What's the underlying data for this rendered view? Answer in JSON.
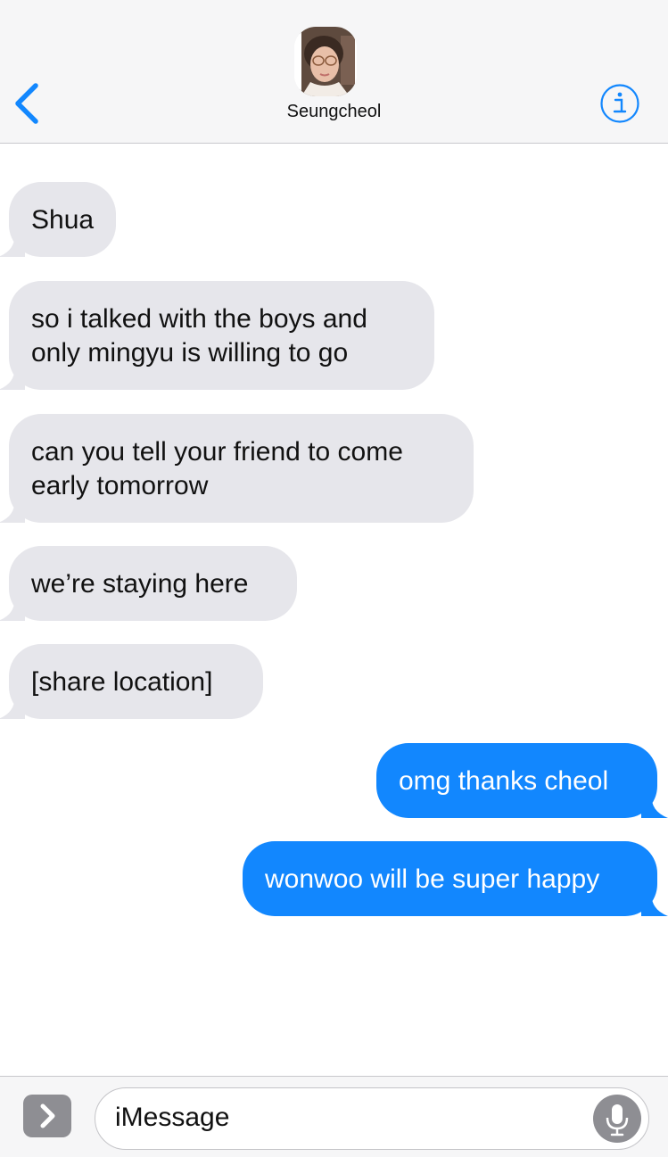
{
  "header": {
    "contact_name": "Seungcheol",
    "back_icon": "chevron-left-icon",
    "info_icon": "info-icon",
    "accent_color": "#1287fe"
  },
  "messages": [
    {
      "direction": "incoming",
      "text_lines": [
        "Shua"
      ]
    },
    {
      "direction": "incoming",
      "text_lines": [
        "so i talked with the boys and",
        "only mingyu is willing to go"
      ]
    },
    {
      "direction": "incoming",
      "text_lines": [
        "can you tell your friend to come",
        "early tomorrow"
      ]
    },
    {
      "direction": "incoming",
      "text_lines": [
        "we’re staying here"
      ]
    },
    {
      "direction": "incoming",
      "text_lines": [
        "[share location]"
      ]
    },
    {
      "direction": "outgoing",
      "text_lines": [
        "omg thanks cheol"
      ]
    },
    {
      "direction": "outgoing",
      "text_lines": [
        "wonwoo will be super happy"
      ]
    }
  ],
  "colors": {
    "incoming_bubble": "#e6e6eb",
    "outgoing_bubble": "#1287fe"
  },
  "composer": {
    "placeholder": "iMessage",
    "apps_icon": "chevron-right-icon",
    "mic_icon": "microphone-icon"
  }
}
